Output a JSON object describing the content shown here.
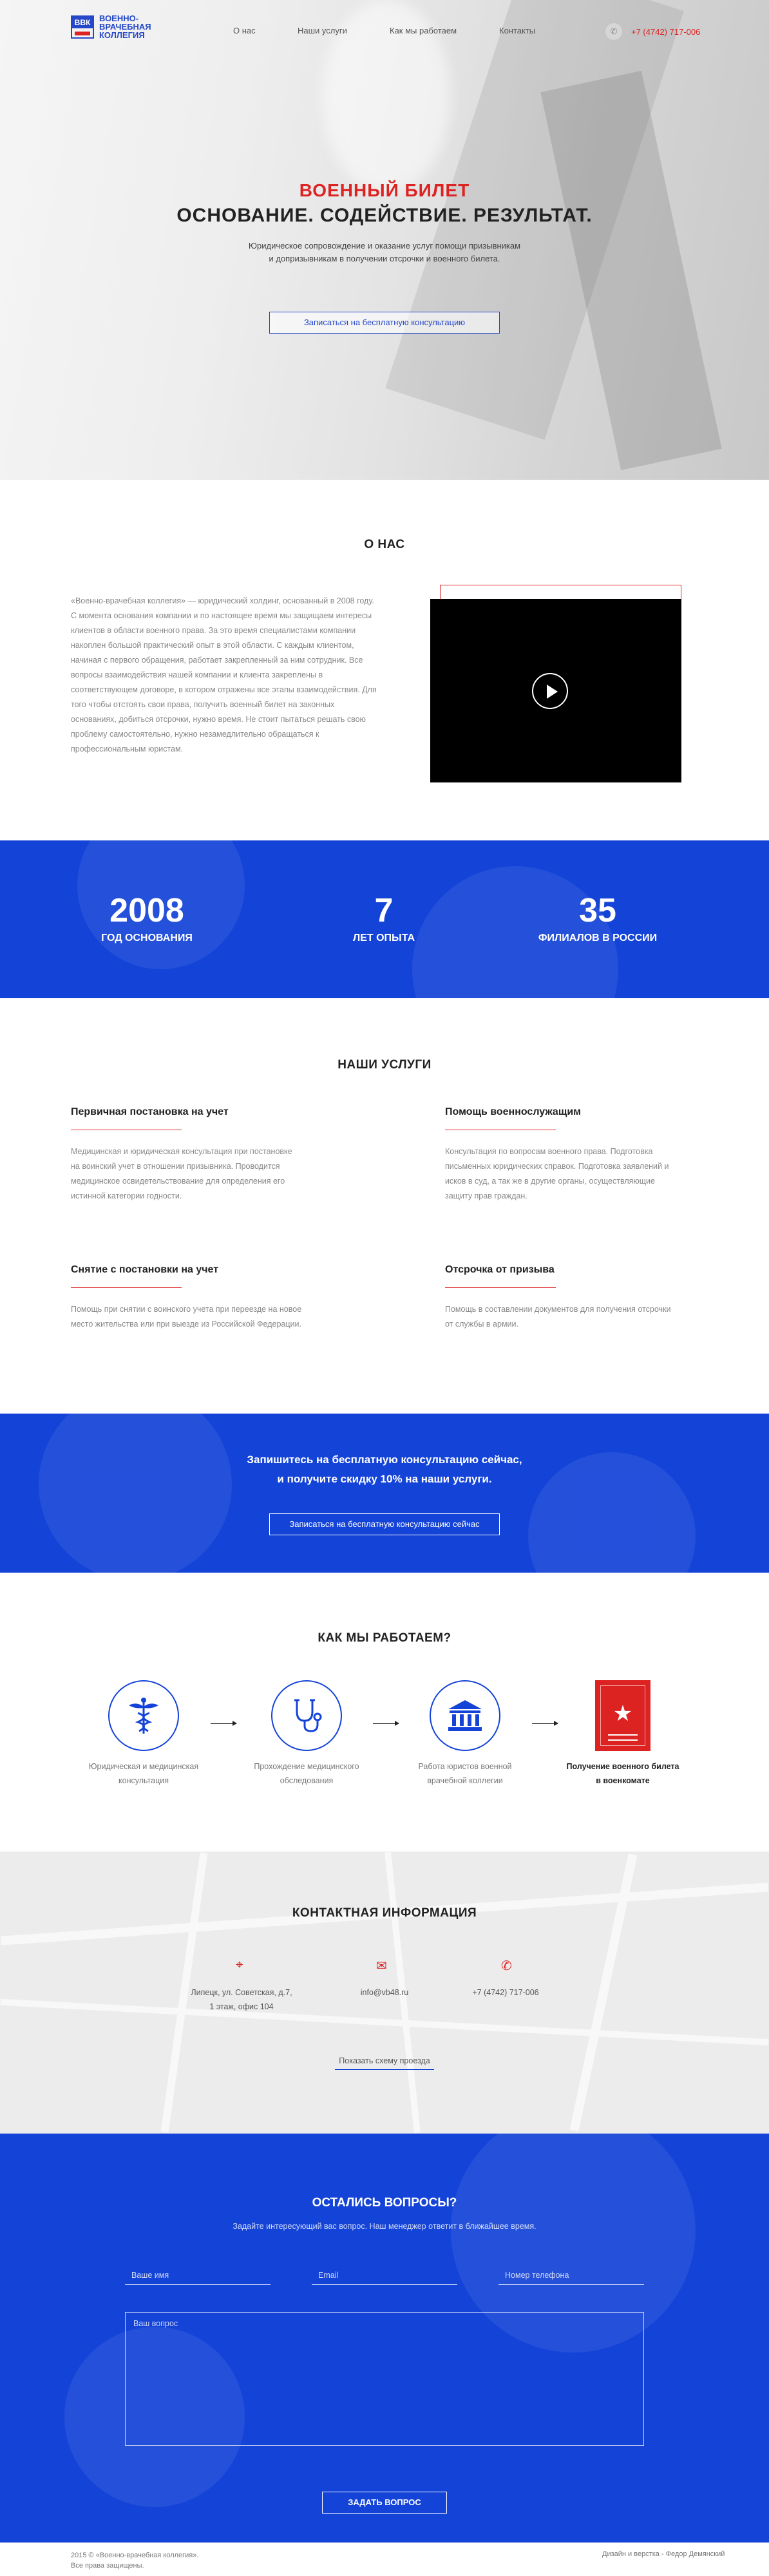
{
  "header": {
    "logo_badge": "ВВК",
    "logo_text": "Военно-врачебная коллегия",
    "nav": [
      "О нас",
      "Наши услуги",
      "Как мы работаем",
      "Контакты"
    ],
    "phone": "+7 (4742) 717-006"
  },
  "hero": {
    "red_title": "Военный билет",
    "title": "Основание. Содействие. Результат.",
    "subtitle_line1": "Юридическое сопровождение и оказание услуг помощи призывникам",
    "subtitle_line2": "и допризывникам в получении отсрочки и военного билета.",
    "button": "Записаться на бесплатную консультацию"
  },
  "about": {
    "title": "О нас",
    "text": "«Военно-врачебная коллегия» — юридический холдинг, основанный в 2008 году. С момента основания компании и по настоящее время мы защищаем интересы клиентов в области военного права. За это время специалистами компании накоплен большой практический опыт в этой области. С каждым клиентом, начиная с первого обращения, работает закрепленный за ним сотрудник. Все вопросы взаимодействия нашей компании и клиента закреплены в соответствующем договоре, в котором отражены все этапы взаимодействия. Для того чтобы отстоять свои права, получить военный билет на законных основаниях, добиться отсрочки, нужно время. Не стоит пытаться решать свою проблему самостоятельно, нужно незамедлительно обращаться к профессиональным юристам."
  },
  "stats": [
    {
      "value": "2008",
      "label": "Год основания"
    },
    {
      "value": "7",
      "label": "Лет опыта"
    },
    {
      "value": "35",
      "label": "Филиалов в России"
    }
  ],
  "services": {
    "title": "Наши услуги",
    "items": [
      {
        "title": "Первичная постановка на учет",
        "text": "Медицинская и юридическая консультация при постановке на воинский учет в отношении призывника. Проводится медицинское освидетельствование для определения его истинной категории годности."
      },
      {
        "title": "Помощь военнослужащим",
        "text": "Консультация по вопросам военного права. Подготовка письменных юридических справок. Подготовка заявлений и исков в суд, а так же в другие органы, осуществляющие защиту прав граждан."
      },
      {
        "title": "Снятие с постановки на учет",
        "text": "Помощь при снятии с воинского учета при переезде на новое место жительства или при выезде из Российской Федерации."
      },
      {
        "title": "Отсрочка от призыва",
        "text": "Помощь в составлении документов для получения отсрочки от службы в армии."
      }
    ]
  },
  "cta": {
    "line1": "Запишитесь на бесплатную консультацию сейчас,",
    "line2": "и получите скидку 10% на наши услуги.",
    "button": "Записаться на бесплатную консультацию сейчас"
  },
  "how": {
    "title": "Как мы работаем?",
    "steps": [
      {
        "icon": "caduceus-icon",
        "line1": "Юридическая и медицинская",
        "line2": "консультация"
      },
      {
        "icon": "stethoscope-icon",
        "line1": "Прохождение медицинского",
        "line2": "обследования"
      },
      {
        "icon": "court-building-icon",
        "line1": "Работа юристов военной",
        "line2": "врачебной коллегии"
      },
      {
        "icon": "military-id-icon",
        "line1": "Получение военного билета",
        "line2": "в военкомате"
      }
    ]
  },
  "contacts": {
    "title": "Контактная информация",
    "address_line1": "Липецк, ул. Советская, д.7,",
    "address_line2": "1 этаж, офис 104",
    "email": "info@vb48.ru",
    "phone": "+7 (4742) 717-006",
    "map_link": "Показать схему проезда"
  },
  "form": {
    "title": "Остались вопросы?",
    "subtitle": "Задайте интересующий вас вопрос. Наш менеджер ответит в ближайшее время.",
    "name_placeholder": "Ваше имя",
    "email_placeholder": "Email",
    "phone_placeholder": "Номер телефона",
    "question_placeholder": "Ваш вопрос",
    "submit": "Задать вопрос"
  },
  "footer": {
    "copyright_line1": "2015 © «Военно-врачебная коллегия».",
    "copyright_line2": "Все права защищены.",
    "credit": "Дизайн и верстка - Федор Демянский"
  },
  "colors": {
    "accent_blue": "#1443d8",
    "accent_red": "#dd2222"
  }
}
